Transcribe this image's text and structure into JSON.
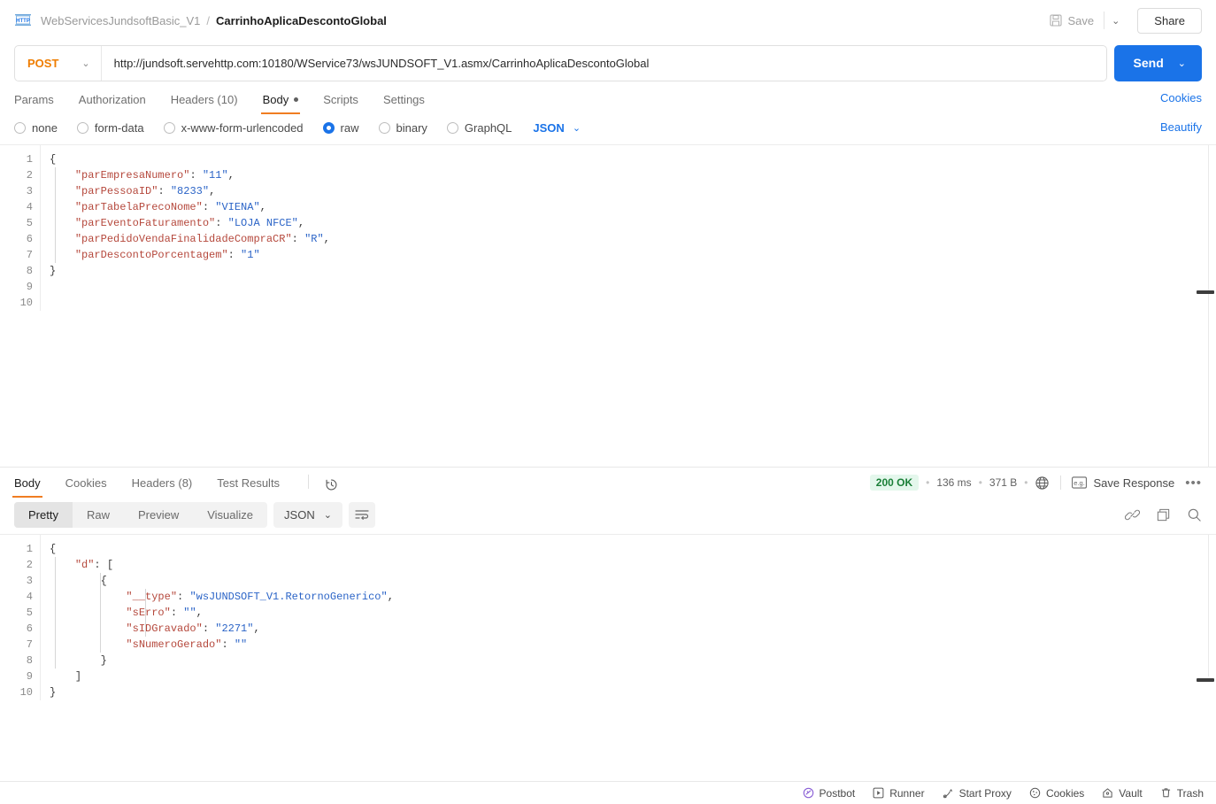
{
  "header": {
    "collection": "WebServicesJundsoftBasic_V1",
    "separator": "/",
    "request_name": "CarrinhoAplicaDescontoGlobal",
    "save_label": "Save",
    "share_label": "Share",
    "caret": "⌄"
  },
  "url_bar": {
    "method": "POST",
    "method_caret": "⌄",
    "url": "http://jundsoft.servehttp.com:10180/WService73/wsJUNDSOFT_V1.asmx/CarrinhoAplicaDescontoGlobal",
    "send_label": "Send",
    "send_caret": "⌄"
  },
  "request_tabs": {
    "items": [
      {
        "label": "Params",
        "active": false,
        "dot": false
      },
      {
        "label": "Authorization",
        "active": false,
        "dot": false
      },
      {
        "label": "Headers (10)",
        "active": false,
        "dot": false
      },
      {
        "label": "Body",
        "active": true,
        "dot": true
      },
      {
        "label": "Scripts",
        "active": false,
        "dot": false
      },
      {
        "label": "Settings",
        "active": false,
        "dot": false
      }
    ],
    "cookies_link": "Cookies"
  },
  "body_type": {
    "options": [
      {
        "label": "none",
        "selected": false
      },
      {
        "label": "form-data",
        "selected": false
      },
      {
        "label": "x-www-form-urlencoded",
        "selected": false
      },
      {
        "label": "raw",
        "selected": true
      },
      {
        "label": "binary",
        "selected": false
      },
      {
        "label": "GraphQL",
        "selected": false
      }
    ],
    "format": "JSON",
    "format_caret": "⌄",
    "beautify_link": "Beautify"
  },
  "request_body": {
    "line_numbers": [
      "1",
      "2",
      "3",
      "4",
      "5",
      "6",
      "7",
      "8",
      "9",
      "10"
    ],
    "lines": [
      {
        "indent": 0,
        "tokens": [
          {
            "t": "p",
            "v": "{"
          }
        ]
      },
      {
        "indent": 1,
        "tokens": [
          {
            "t": "k",
            "v": "\"parEmpresaNumero\""
          },
          {
            "t": "p",
            "v": ": "
          },
          {
            "t": "s",
            "v": "\"11\""
          },
          {
            "t": "p",
            "v": ","
          }
        ]
      },
      {
        "indent": 1,
        "tokens": [
          {
            "t": "k",
            "v": "\"parPessoaID\""
          },
          {
            "t": "p",
            "v": ": "
          },
          {
            "t": "s",
            "v": "\"8233\""
          },
          {
            "t": "p",
            "v": ","
          }
        ]
      },
      {
        "indent": 1,
        "tokens": [
          {
            "t": "k",
            "v": "\"parTabelaPrecoNome\""
          },
          {
            "t": "p",
            "v": ": "
          },
          {
            "t": "s",
            "v": "\"VIENA\""
          },
          {
            "t": "p",
            "v": ","
          }
        ]
      },
      {
        "indent": 1,
        "tokens": [
          {
            "t": "k",
            "v": "\"parEventoFaturamento\""
          },
          {
            "t": "p",
            "v": ": "
          },
          {
            "t": "s",
            "v": "\"LOJA NFCE\""
          },
          {
            "t": "p",
            "v": ","
          }
        ]
      },
      {
        "indent": 1,
        "tokens": [
          {
            "t": "k",
            "v": "\"parPedidoVendaFinalidadeCompraCR\""
          },
          {
            "t": "p",
            "v": ": "
          },
          {
            "t": "s",
            "v": "\"R\""
          },
          {
            "t": "p",
            "v": ","
          }
        ]
      },
      {
        "indent": 1,
        "tokens": [
          {
            "t": "k",
            "v": "\"parDescontoPorcentagem\""
          },
          {
            "t": "p",
            "v": ": "
          },
          {
            "t": "s",
            "v": "\"1\""
          }
        ]
      },
      {
        "indent": 0,
        "tokens": [
          {
            "t": "p",
            "v": "}"
          }
        ]
      },
      {
        "indent": 0,
        "tokens": []
      },
      {
        "indent": 0,
        "tokens": []
      }
    ]
  },
  "response_tabs": {
    "items": [
      {
        "label": "Body",
        "active": true
      },
      {
        "label": "Cookies",
        "active": false
      },
      {
        "label": "Headers (8)",
        "active": false
      },
      {
        "label": "Test Results",
        "active": false
      }
    ],
    "status": "200 OK",
    "time": "136 ms",
    "size": "371 B",
    "dot": "•",
    "save_response": "Save Response",
    "ellipsis": "•••"
  },
  "response_toolbar": {
    "views": [
      {
        "label": "Pretty",
        "active": true
      },
      {
        "label": "Raw",
        "active": false
      },
      {
        "label": "Preview",
        "active": false
      },
      {
        "label": "Visualize",
        "active": false
      }
    ],
    "format": "JSON",
    "format_caret": "⌄"
  },
  "response_body": {
    "line_numbers": [
      "1",
      "2",
      "3",
      "4",
      "5",
      "6",
      "7",
      "8",
      "9",
      "10"
    ],
    "lines": [
      {
        "indent": 0,
        "tokens": [
          {
            "t": "p",
            "v": "{"
          }
        ]
      },
      {
        "indent": 1,
        "tokens": [
          {
            "t": "k",
            "v": "\"d\""
          },
          {
            "t": "p",
            "v": ": ["
          }
        ]
      },
      {
        "indent": 2,
        "tokens": [
          {
            "t": "p",
            "v": "{"
          }
        ]
      },
      {
        "indent": 3,
        "tokens": [
          {
            "t": "k",
            "v": "\"__type\""
          },
          {
            "t": "p",
            "v": ": "
          },
          {
            "t": "s",
            "v": "\"wsJUNDSOFT_V1.RetornoGenerico\""
          },
          {
            "t": "p",
            "v": ","
          }
        ]
      },
      {
        "indent": 3,
        "tokens": [
          {
            "t": "k",
            "v": "\"sErro\""
          },
          {
            "t": "p",
            "v": ": "
          },
          {
            "t": "s",
            "v": "\"\""
          },
          {
            "t": "p",
            "v": ","
          }
        ]
      },
      {
        "indent": 3,
        "tokens": [
          {
            "t": "k",
            "v": "\"sIDGravado\""
          },
          {
            "t": "p",
            "v": ": "
          },
          {
            "t": "s",
            "v": "\"2271\""
          },
          {
            "t": "p",
            "v": ","
          }
        ]
      },
      {
        "indent": 3,
        "tokens": [
          {
            "t": "k",
            "v": "\"sNumeroGerado\""
          },
          {
            "t": "p",
            "v": ": "
          },
          {
            "t": "s",
            "v": "\"\""
          }
        ]
      },
      {
        "indent": 2,
        "tokens": [
          {
            "t": "p",
            "v": "}"
          }
        ]
      },
      {
        "indent": 1,
        "tokens": [
          {
            "t": "p",
            "v": "]"
          }
        ]
      },
      {
        "indent": 0,
        "tokens": [
          {
            "t": "p",
            "v": "}"
          }
        ]
      }
    ]
  },
  "statusbar": {
    "items": [
      {
        "label": "Postbot",
        "icon": "postbot-icon"
      },
      {
        "label": "Runner",
        "icon": "runner-icon"
      },
      {
        "label": "Start Proxy",
        "icon": "proxy-icon"
      },
      {
        "label": "Cookies",
        "icon": "cookies-icon"
      },
      {
        "label": "Vault",
        "icon": "vault-icon"
      },
      {
        "label": "Trash",
        "icon": "trash-icon"
      }
    ]
  },
  "colors": {
    "accent_orange": "#f07d22",
    "link_blue": "#1a73e8",
    "method_orange": "#ef7d00",
    "status_green": "#1a7f37"
  }
}
